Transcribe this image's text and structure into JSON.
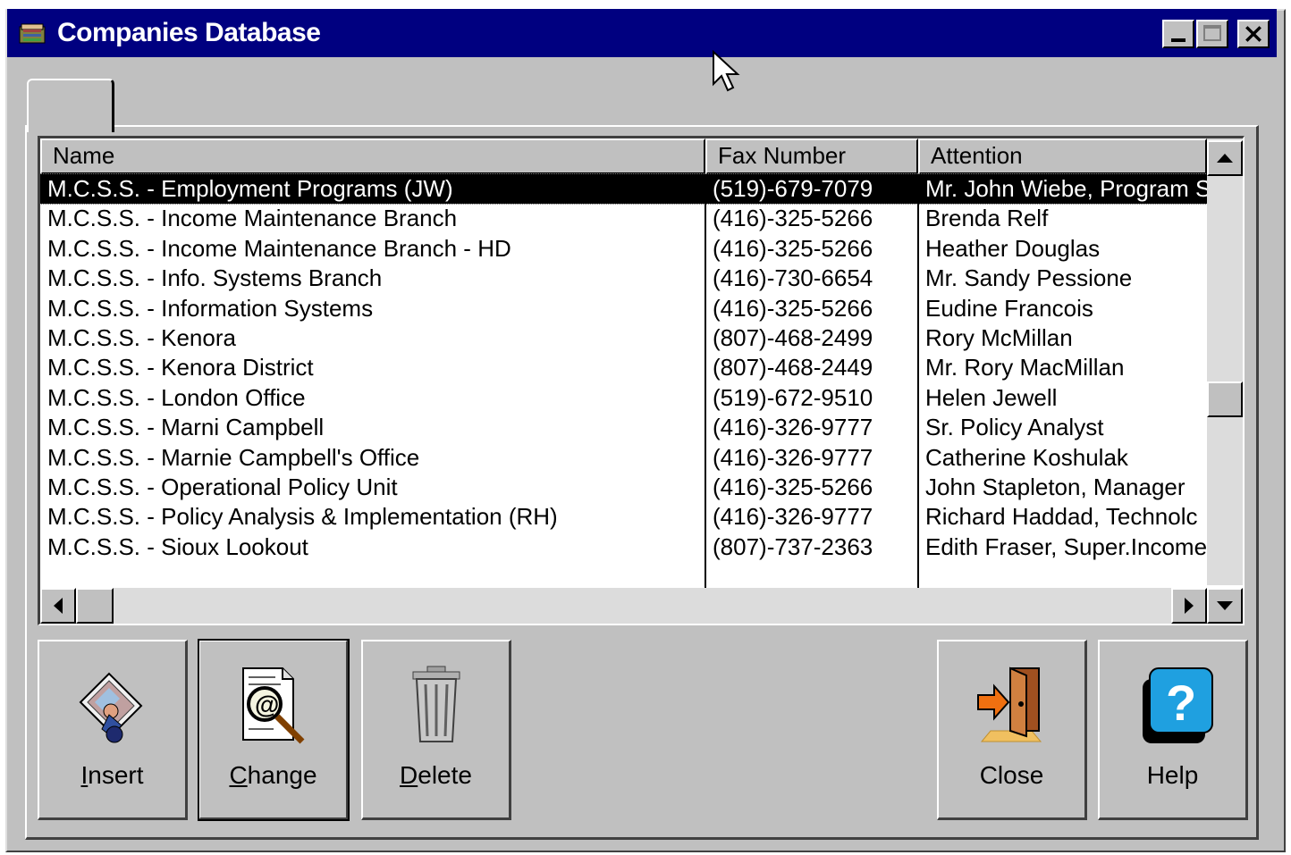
{
  "window": {
    "title": "Companies Database",
    "minimize": "minimize",
    "maximize": "maximize",
    "close": "close"
  },
  "tabs": [
    {
      "label": ""
    }
  ],
  "list": {
    "columns": [
      "Name",
      "Fax Number",
      "Attention"
    ],
    "rows": [
      {
        "name": "M.C.S.S. - Employment Programs (JW)",
        "fax": "(519)-679-7079",
        "attention": "Mr. John Wiebe, Program S",
        "selected": true
      },
      {
        "name": "M.C.S.S. - Income Maintenance Branch",
        "fax": "(416)-325-5266",
        "attention": "Brenda Relf"
      },
      {
        "name": "M.C.S.S. - Income Maintenance Branch - HD",
        "fax": "(416)-325-5266",
        "attention": "Heather Douglas"
      },
      {
        "name": "M.C.S.S. - Info. Systems Branch",
        "fax": "(416)-730-6654",
        "attention": "Mr. Sandy Pessione"
      },
      {
        "name": "M.C.S.S. - Information Systems",
        "fax": "(416)-325-5266",
        "attention": "Eudine Francois"
      },
      {
        "name": "M.C.S.S. - Kenora",
        "fax": "(807)-468-2499",
        "attention": "Rory McMillan"
      },
      {
        "name": "M.C.S.S. - Kenora District",
        "fax": "(807)-468-2449",
        "attention": "Mr. Rory MacMillan"
      },
      {
        "name": "M.C.S.S. - London Office",
        "fax": "(519)-672-9510",
        "attention": "Helen Jewell"
      },
      {
        "name": "M.C.S.S. - Marni Campbell",
        "fax": "(416)-326-9777",
        "attention": "Sr. Policy Analyst"
      },
      {
        "name": "M.C.S.S. - Marnie Campbell's Office",
        "fax": "(416)-326-9777",
        "attention": "Catherine Koshulak"
      },
      {
        "name": "M.C.S.S. - Operational Policy Unit",
        "fax": "(416)-325-5266",
        "attention": "John Stapleton, Manager"
      },
      {
        "name": "M.C.S.S. - Policy Analysis & Implementation (RH)",
        "fax": "(416)-326-9777",
        "attention": "Richard Haddad, Technolc"
      },
      {
        "name": "M.C.S.S. - Sioux Lookout",
        "fax": "(807)-737-2363",
        "attention": "Edith Fraser, Super.Income"
      }
    ],
    "vertical_scroll_position": 0.55
  },
  "buttons": [
    {
      "label": "Insert",
      "mnemonic": "I",
      "rest": "nsert",
      "icon": "insert-card-icon"
    },
    {
      "label": "Change",
      "mnemonic": "C",
      "rest": "hange",
      "icon": "change-magnifier-icon"
    },
    {
      "label": "Delete",
      "mnemonic": "D",
      "rest": "elete",
      "icon": "trash-can-icon"
    },
    {
      "label": "Close",
      "mnemonic": "",
      "rest": "Close",
      "icon": "exit-door-icon"
    },
    {
      "label": "Help",
      "mnemonic": "",
      "rest": "Help",
      "icon": "help-question-icon"
    }
  ],
  "colors": {
    "title_bar": "#000080",
    "face": "#c0c0c0",
    "selection": "#000000",
    "help_icon": "#1fa0e0"
  }
}
